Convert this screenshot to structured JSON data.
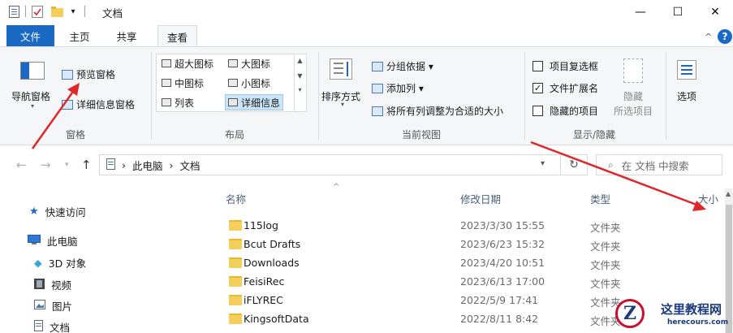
{
  "window": {
    "title": "文档",
    "qat_divider": "|",
    "qat_dropdown": "▾",
    "minimize": "—",
    "maximize": "☐",
    "close": "✕"
  },
  "ribbon_tabs": {
    "file": "文件",
    "home": "主页",
    "share": "共享",
    "view": "查看",
    "collapse": "^",
    "help": "?"
  },
  "ribbon": {
    "panes": {
      "label": "窗格",
      "nav_pane": "导航窗格",
      "preview_pane": "预览窗格",
      "details_pane": "详细信息窗格"
    },
    "layout": {
      "label": "布局",
      "extra_large": "超大图标",
      "large": "大图标",
      "medium": "中图标",
      "small": "小图标",
      "list": "列表",
      "details": "详细信息"
    },
    "current_view": {
      "label": "当前视图",
      "sort_by": "排序方式",
      "group_by": "分组依据 ▾",
      "add_column": "添加列 ▾",
      "fit_columns": "将所有列调整为合适的大小"
    },
    "show_hide": {
      "label": "显示/隐藏",
      "item_checkboxes": "项目复选框",
      "file_extensions": "文件扩展名",
      "hidden_items": "隐藏的项目",
      "hide_selected_1": "隐藏",
      "hide_selected_2": "所选项目",
      "options": "选项"
    }
  },
  "address": {
    "this_pc": "此电脑",
    "folder": "文档",
    "separator": "›",
    "search_placeholder": "在 文档 中搜索"
  },
  "nav_pane": {
    "quick_access": "快速访问",
    "this_pc": "此电脑",
    "objects_3d": "3D 对象",
    "videos": "视频",
    "pictures": "图片",
    "documents": "文档"
  },
  "columns": {
    "name": "名称",
    "date": "修改日期",
    "type": "类型",
    "size": "大小"
  },
  "files": [
    {
      "name": "115log",
      "date": "2023/3/30 15:55",
      "type": "文件夹"
    },
    {
      "name": "Bcut Drafts",
      "date": "2023/6/23 15:32",
      "type": "文件夹"
    },
    {
      "name": "Downloads",
      "date": "2023/4/20 10:51",
      "type": "文件夹"
    },
    {
      "name": "FeisiRec",
      "date": "2023/6/13 17:00",
      "type": "文件夹"
    },
    {
      "name": "iFLYREC",
      "date": "2022/5/9 17:41",
      "type": "文件夹"
    },
    {
      "name": "KingsoftData",
      "date": "2022/8/11 8:42",
      "type": "文件夹"
    }
  ],
  "watermark": {
    "letter": "Z",
    "title": "这里教程网",
    "url": "herecours.com"
  },
  "colors": {
    "accent": "#1a69c4",
    "annotation": "#e0262a",
    "folder": "#f5cf5c"
  }
}
